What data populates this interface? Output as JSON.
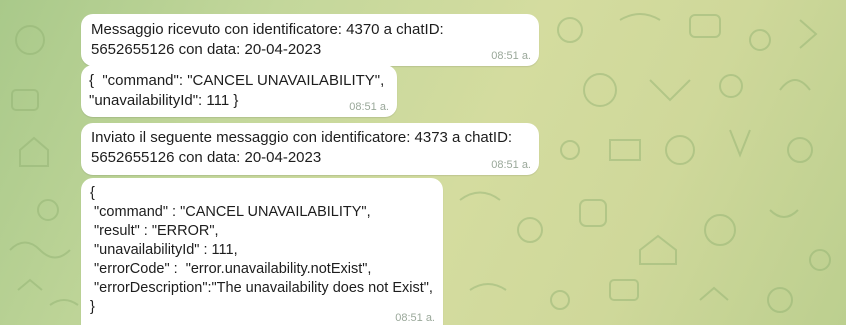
{
  "messages": [
    {
      "text": "Messaggio ricevuto con identificatore: 4370 a chatID:\n5652655126 con data: 20-04-2023",
      "time": "08:51 a."
    },
    {
      "text": "{  \"command\": \"CANCEL UNAVAILABILITY\",\n\"unavailabilityId\": 111 }",
      "time": "08:51 a."
    },
    {
      "text": "Inviato il seguente messaggio con identificatore: 4373 a chatID:\n5652655126 con data: 20-04-2023",
      "time": "08:51 a."
    },
    {
      "text": "{\n \"command\" : \"CANCEL UNAVAILABILITY\",\n \"result\" : \"ERROR\",\n \"unavailabilityId\" : 111,\n \"errorCode\" :  \"error.unavailability.notExist\",\n \"errorDescription\":\"The unavailability does not Exist\",\n}",
      "time": "08:51 a."
    }
  ],
  "colors": {
    "bubble": "#ffffff",
    "text": "#1d1d1d",
    "timestamp": "#9aa89a",
    "wallpaper_start": "#a9c98a",
    "wallpaper_end": "#bccf8f"
  }
}
